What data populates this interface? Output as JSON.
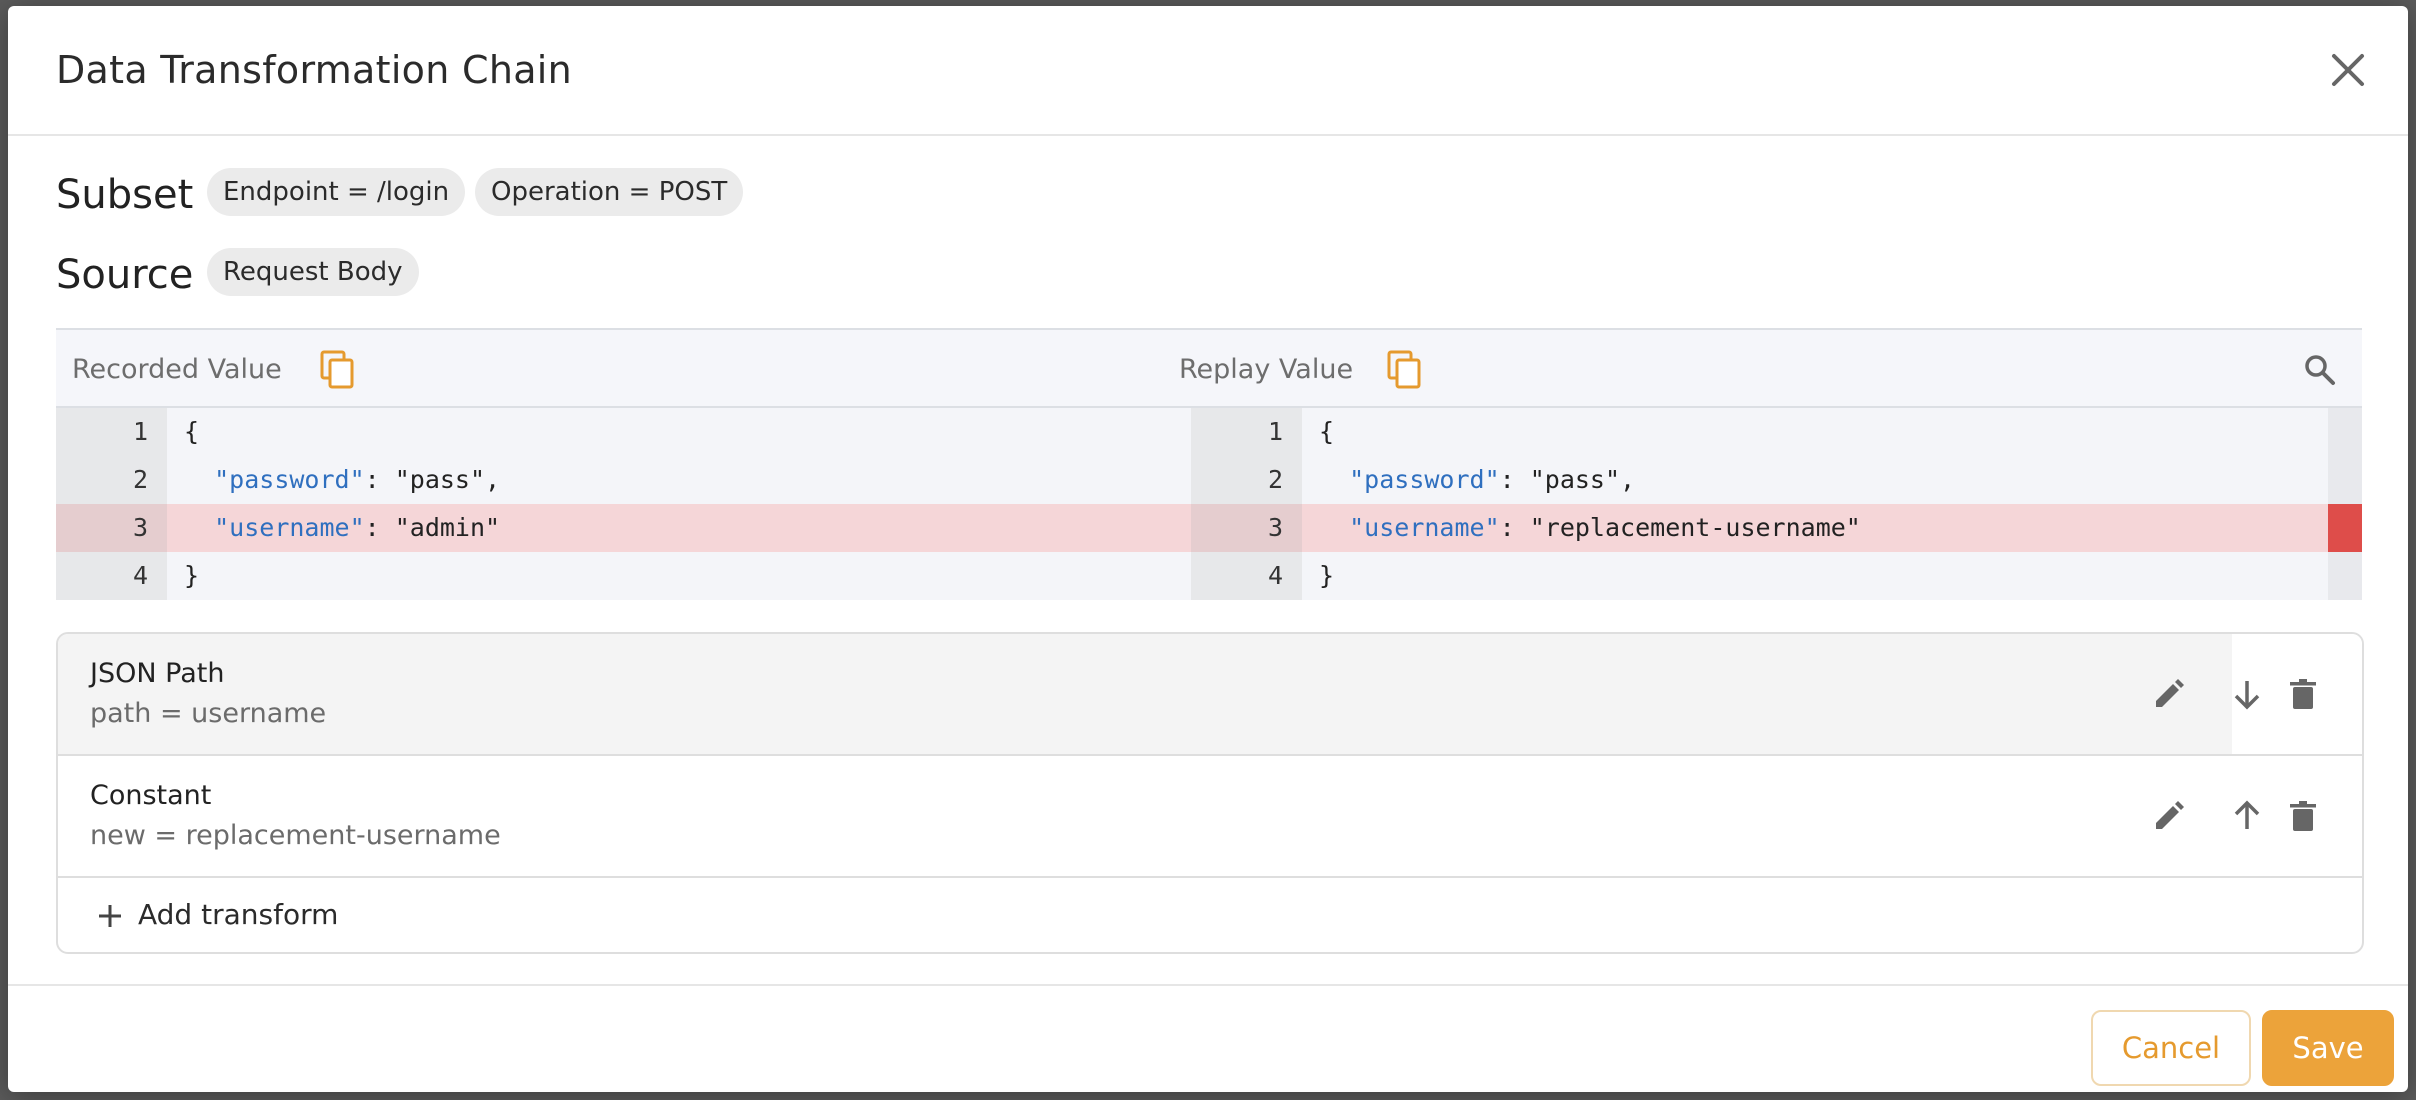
{
  "modal": {
    "title": "Data Transformation Chain"
  },
  "subset": {
    "label": "Subset",
    "chips": [
      "Endpoint = /login",
      "Operation = POST"
    ]
  },
  "source": {
    "label": "Source",
    "chip": "Request Body"
  },
  "diff": {
    "recorded_title": "Recorded Value",
    "replay_title": "Replay Value",
    "recorded_lines": [
      {
        "num": "1",
        "text": "{"
      },
      {
        "num": "2",
        "key": "\"password\"",
        "value": ": \"pass\","
      },
      {
        "num": "3",
        "key": "\"username\"",
        "value": ": \"admin\""
      },
      {
        "num": "4",
        "text": "}"
      }
    ],
    "replay_lines": [
      {
        "num": "1",
        "text": "{"
      },
      {
        "num": "2",
        "key": "\"password\"",
        "value": ": \"pass\","
      },
      {
        "num": "3",
        "key": "\"username\"",
        "value": ": \"replacement-username\""
      },
      {
        "num": "4",
        "text": "}"
      }
    ],
    "changed_line": 3
  },
  "transforms": [
    {
      "name": "JSON Path",
      "desc": "path = username",
      "move": "down"
    },
    {
      "name": "Constant",
      "desc": "new = replacement-username",
      "move": "up"
    }
  ],
  "add_transform_label": "Add transform",
  "footer": {
    "cancel_label": "Cancel",
    "save_label": "Save"
  },
  "colors": {
    "accent": "#eca33a",
    "json_key": "#2f6fbf",
    "diff_highlight": "#f5d6d8",
    "diff_marker": "#de4d4a"
  }
}
